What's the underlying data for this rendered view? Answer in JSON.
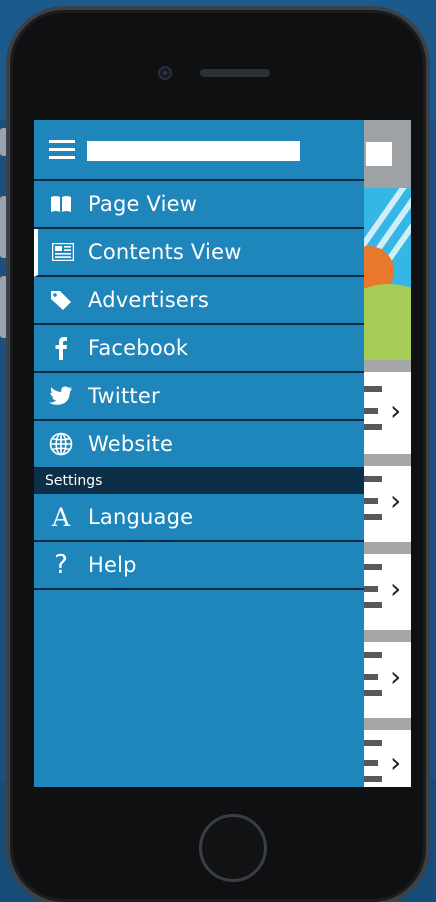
{
  "search": {
    "value": "",
    "placeholder": ""
  },
  "menu": {
    "items": [
      {
        "label": "Page View",
        "icon": "book-icon"
      },
      {
        "label": "Contents View",
        "icon": "newspaper-icon"
      },
      {
        "label": "Advertisers",
        "icon": "tag-icon"
      },
      {
        "label": "Facebook",
        "icon": "facebook-icon"
      },
      {
        "label": "Twitter",
        "icon": "twitter-icon"
      },
      {
        "label": "Website",
        "icon": "globe-icon"
      }
    ],
    "section_label": "Settings",
    "settings": [
      {
        "label": "Language",
        "icon": "letter-a-icon",
        "glyph": "A"
      },
      {
        "label": "Help",
        "icon": "question-icon",
        "glyph": "?"
      }
    ]
  },
  "colors": {
    "drawer": "#1f86bb",
    "divider": "#0b2a40",
    "section": "#0d2e47",
    "phone": "#0f1011"
  }
}
